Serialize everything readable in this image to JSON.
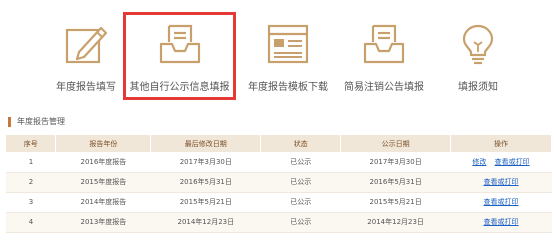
{
  "colors": {
    "accent": "#c8a06b",
    "highlight": "#e53935",
    "link": "#1a5fc2"
  },
  "toolbar": {
    "items": [
      {
        "label": "年度报告填写",
        "icon": "pencil-edit-icon"
      },
      {
        "label": "其他自行公示信息填报",
        "icon": "inbox-tray-icon"
      },
      {
        "label": "年度报告模板下载",
        "icon": "template-grid-icon"
      },
      {
        "label": "简易注销公告填报",
        "icon": "inbox-tray-icon"
      },
      {
        "label": "填报须知",
        "icon": "lightbulb-icon"
      }
    ]
  },
  "section": {
    "title": "年度报告管理"
  },
  "table": {
    "headers": [
      "序号",
      "报告年份",
      "最后修改日期",
      "状态",
      "公示日期",
      "操作"
    ],
    "rows": [
      {
        "no": "1",
        "year": "2016年度报告",
        "modified": "2017年3月30日",
        "status": "已公示",
        "published": "2017年3月30日",
        "actions": [
          "修改",
          "查看或打印"
        ]
      },
      {
        "no": "2",
        "year": "2015年度报告",
        "modified": "2016年5月31日",
        "status": "已公示",
        "published": "2016年5月31日",
        "actions": [
          "查看或打印"
        ]
      },
      {
        "no": "3",
        "year": "2014年度报告",
        "modified": "2015年5月21日",
        "status": "已公示",
        "published": "2015年5月21日",
        "actions": [
          "查看或打印"
        ]
      },
      {
        "no": "4",
        "year": "2013年度报告",
        "modified": "2014年12月23日",
        "status": "已公示",
        "published": "2014年12月23日",
        "actions": [
          "查看或打印"
        ]
      }
    ]
  }
}
